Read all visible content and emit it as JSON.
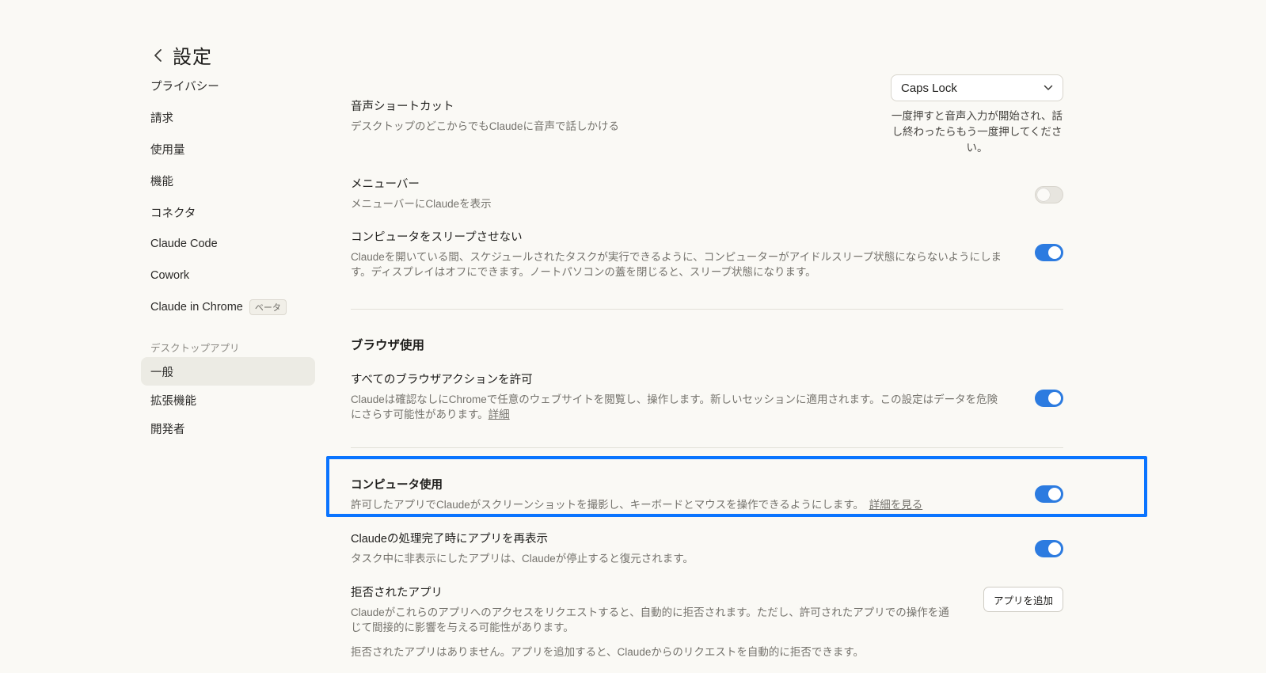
{
  "header": {
    "title": "設定"
  },
  "sidebar": {
    "items": [
      {
        "label": "プライバシー"
      },
      {
        "label": "請求"
      },
      {
        "label": "使用量"
      },
      {
        "label": "機能"
      },
      {
        "label": "コネクタ"
      },
      {
        "label": "Claude Code"
      },
      {
        "label": "Cowork"
      },
      {
        "label": "Claude in Chrome",
        "badge": "ベータ"
      }
    ],
    "section_label": "デスクトップアプリ",
    "desktop_items": [
      {
        "label": "一般",
        "active": true
      },
      {
        "label": "拡張機能"
      },
      {
        "label": "開発者"
      }
    ]
  },
  "settings": {
    "voice_shortcut": {
      "title": "音声ショートカット",
      "desc": "デスクトップのどこからでもClaudeに音声で話しかける",
      "select_value": "Caps Lock",
      "help": "一度押すと音声入力が開始され、話し終わったらもう一度押してください。"
    },
    "menubar": {
      "title": "メニューバー",
      "desc": "メニューバーにClaudeを表示",
      "enabled": false
    },
    "no_sleep": {
      "title": "コンピュータをスリープさせない",
      "desc": "Claudeを開いている間、スケジュールされたタスクが実行できるように、コンピューターがアイドルスリープ状態にならないようにします。ディスプレイはオフにできます。ノートパソコンの蓋を閉じると、スリープ状態になります。",
      "enabled": true
    }
  },
  "browser": {
    "section_title": "ブラウザ使用",
    "allow_all": {
      "title": "すべてのブラウザアクションを許可",
      "desc": "Claudeは確認なしにChromeで任意のウェブサイトを閲覧し、操作します。新しいセッションに適用されます。この設定はデータを危険にさらす可能性があります。",
      "link": "詳細",
      "enabled": true
    }
  },
  "computer": {
    "use": {
      "title": "コンピュータ使用",
      "desc": "許可したアプリでClaudeがスクリーンショットを撮影し、キーボードとマウスを操作できるようにします。",
      "link": "詳細を見る",
      "enabled": true
    },
    "reshow": {
      "title": "Claudeの処理完了時にアプリを再表示",
      "desc": "タスク中に非表示にしたアプリは、Claudeが停止すると復元されます。",
      "enabled": true
    },
    "denied": {
      "title": "拒否されたアプリ",
      "desc": "Claudeがこれらのアプリへのアクセスをリクエストすると、自動的に拒否されます。ただし、許可されたアプリでの操作を通じて間接的に影響を与える可能性があります。",
      "button": "アプリを追加",
      "empty": "拒否されたアプリはありません。アプリを追加すると、Claudeからのリクエストを自動的に拒否できます。"
    }
  },
  "colors": {
    "accent": "#2c7be0",
    "highlight": "#0a74ff",
    "background": "#faf9f5"
  }
}
